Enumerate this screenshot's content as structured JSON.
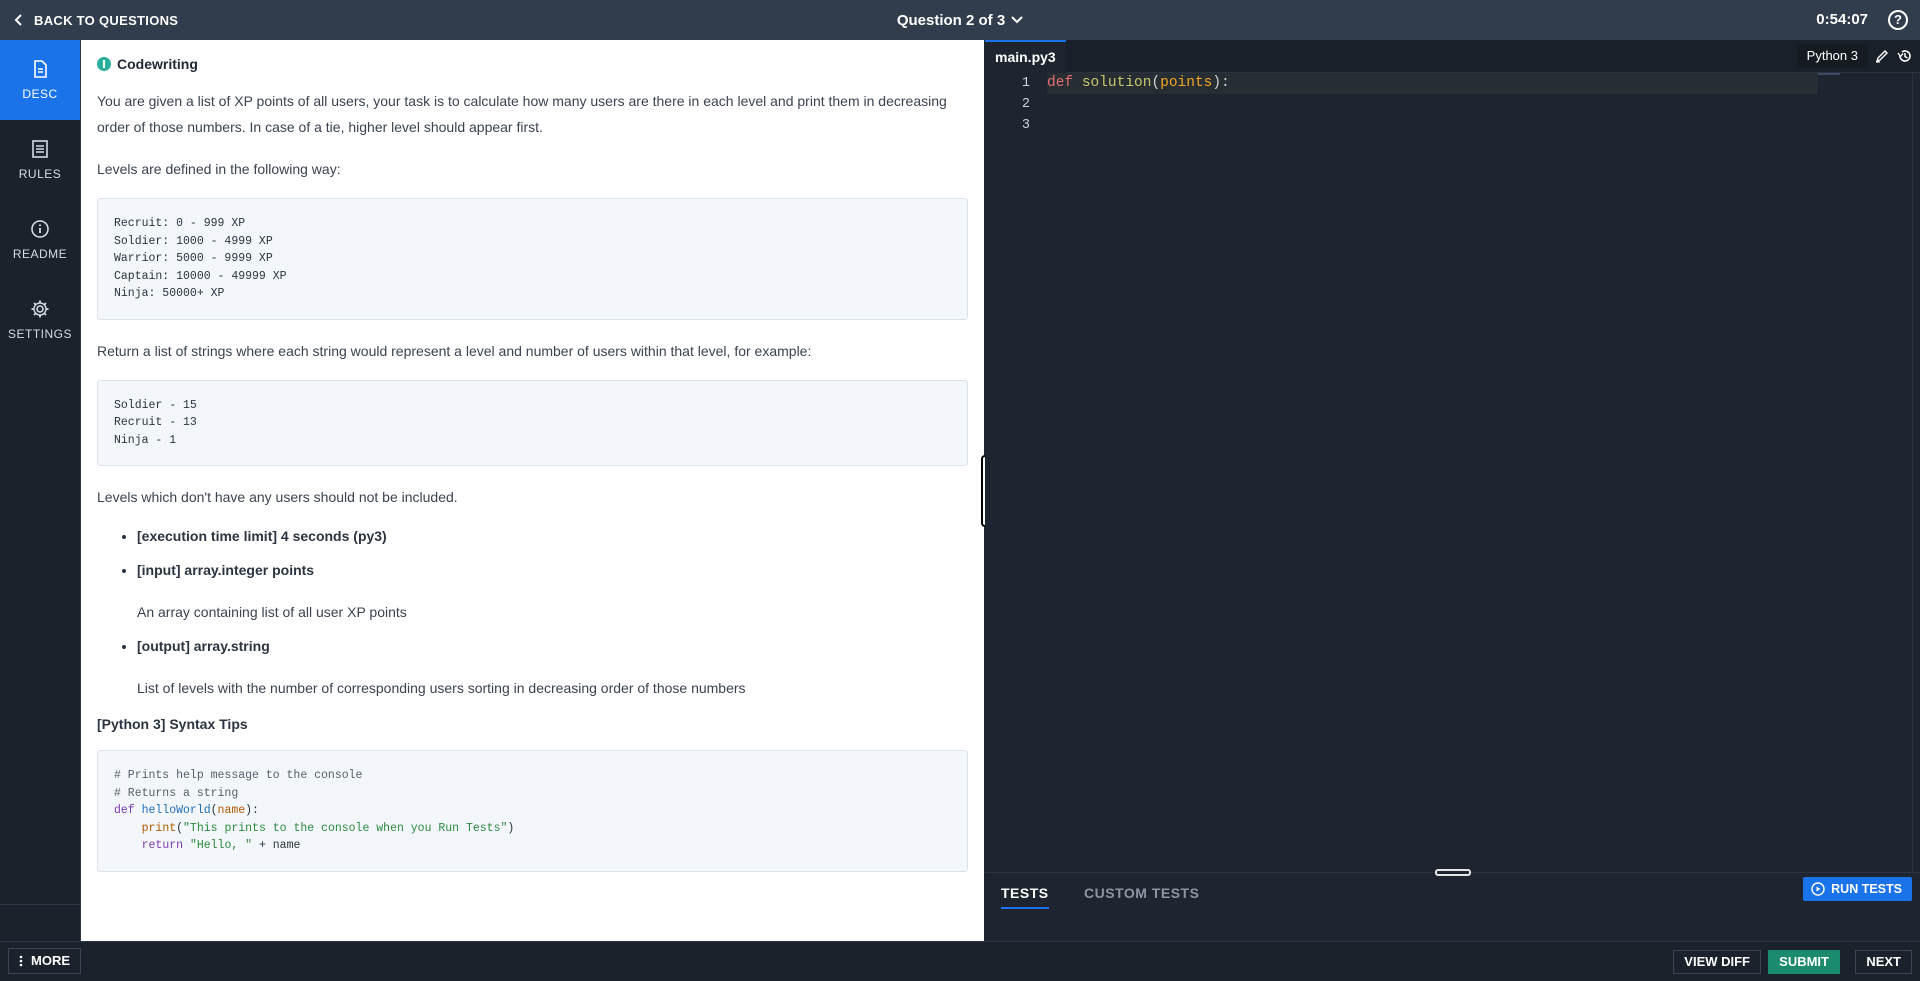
{
  "header": {
    "back_label": "BACK TO QUESTIONS",
    "question_title": "Question 2 of 3",
    "timer": "0:54:07",
    "help_glyph": "?"
  },
  "sidebar": {
    "items": [
      {
        "label": "DESC",
        "icon": "document-icon",
        "active": true
      },
      {
        "label": "RULES",
        "icon": "list-icon",
        "active": false
      },
      {
        "label": "README",
        "icon": "info-icon",
        "active": false
      },
      {
        "label": "SETTINGS",
        "icon": "gear-icon",
        "active": false
      }
    ]
  },
  "description": {
    "type_label": "Codewriting",
    "intro": "You are given a list of XP points of all users, your task is to calculate how many users are there in each level and print them in decreasing order of those numbers. In case of a tie, higher level should appear first.",
    "levels_intro": "Levels are defined in the following way:",
    "levels_code": "Recruit: 0 - 999 XP\nSoldier: 1000 - 4999 XP\nWarrior: 5000 - 9999 XP\nCaptain: 10000 - 49999 XP\nNinja: 50000+ XP",
    "return_text": "Return a list of strings where each string would represent a level and number of users within that level, for example:",
    "example_code": "Soldier - 15\nRecruit - 13\nNinja - 1",
    "note": "Levels which don't have any users should not be included.",
    "bullets": [
      {
        "title": "[execution time limit] 4 seconds (py3)",
        "detail": ""
      },
      {
        "title": "[input] array.integer points",
        "detail": "An array containing list of all user XP points"
      },
      {
        "title": "[output] array.string",
        "detail": "List of levels with the number of corresponding users sorting in decreasing order of those numbers"
      }
    ],
    "tips_title": "[Python 3] Syntax Tips",
    "tips": {
      "comment1": "# Prints help message to the console",
      "comment2": "# Returns a string",
      "def_kw": "def",
      "fn_name": "helloWorld",
      "param": "name",
      "print_kw": "print",
      "print_str": "\"This prints to the console when you Run Tests\"",
      "return_kw": "return",
      "return_str": "\"Hello, \"",
      "return_rest": " + name"
    }
  },
  "editor": {
    "file_tab": "main.py3",
    "language": "Python 3",
    "line_numbers": [
      "1",
      "2",
      "3"
    ],
    "code_line1": {
      "kw": "def",
      "fn": "solution",
      "param": "points"
    }
  },
  "tests": {
    "tab_tests": "TESTS",
    "tab_custom": "CUSTOM TESTS",
    "run_label": "RUN TESTS"
  },
  "footer": {
    "more_label": "MORE",
    "view_diff": "VIEW DIFF",
    "submit": "SUBMIT",
    "next": "NEXT"
  },
  "colors": {
    "accent": "#1a73e8",
    "submit": "#1c8a6c",
    "topbar": "#313d4d"
  }
}
